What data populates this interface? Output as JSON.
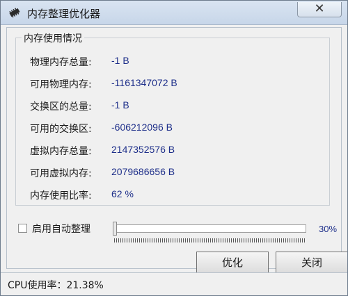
{
  "window": {
    "title": "内存整理优化器",
    "close_glyph": "✕"
  },
  "memory_info": {
    "group_title": "内存使用情况",
    "rows": [
      {
        "label": "物理内存总量:",
        "value": "-1 B"
      },
      {
        "label": "可用物理内存:",
        "value": "-1161347072 B"
      },
      {
        "label": "交换区的总量:",
        "value": "-1 B"
      },
      {
        "label": "可用的交换区:",
        "value": "-606212096 B"
      },
      {
        "label": "虚拟内存总量:",
        "value": "2147352576 B"
      },
      {
        "label": "可用虚拟内存:",
        "value": "2079686656 B"
      },
      {
        "label": "内存使用比率:",
        "value": "62 %"
      }
    ]
  },
  "auto_organize": {
    "label": "启用自动整理",
    "checked": false,
    "percent_text": "30%"
  },
  "buttons": {
    "optimize_label": "优化",
    "close_label": "关闭"
  },
  "status": {
    "cpu_text": "CPU使用率：21.38%"
  }
}
